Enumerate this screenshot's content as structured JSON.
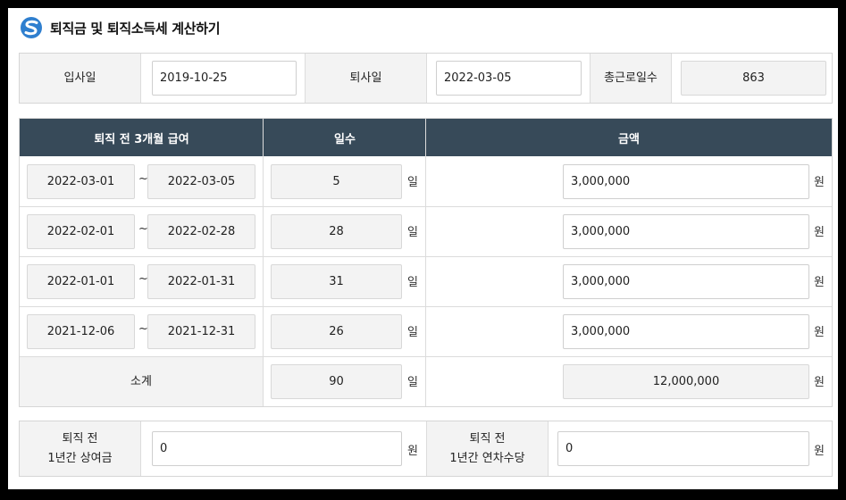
{
  "page_title": "퇴직금 및 퇴직소득세 계산하기",
  "colors": {
    "header_bg": "#374a59",
    "logo_blue": "#2f7fcf",
    "label_bg": "#f3f3f3"
  },
  "employment": {
    "start_label": "입사일",
    "start_date": "2019-10-25",
    "end_label": "퇴사일",
    "end_date": "2022-03-05",
    "total_days_label": "총근로일수",
    "total_days": "863"
  },
  "salary_table": {
    "headers": [
      "퇴직 전 3개월 급여",
      "일수",
      "금액"
    ],
    "rows": [
      {
        "from": "2022-03-01",
        "to": "2022-03-05",
        "days": "5",
        "amount": "3,000,000"
      },
      {
        "from": "2022-02-01",
        "to": "2022-02-28",
        "days": "28",
        "amount": "3,000,000"
      },
      {
        "from": "2022-01-01",
        "to": "2022-01-31",
        "days": "31",
        "amount": "3,000,000"
      },
      {
        "from": "2021-12-06",
        "to": "2021-12-31",
        "days": "26",
        "amount": "3,000,000"
      }
    ],
    "subtotal_label": "소계",
    "subtotal_days": "90",
    "subtotal_amount": "12,000,000",
    "range_sep": "~",
    "day_unit": "일",
    "won_unit": "원"
  },
  "extras": {
    "bonus_label_1": "퇴직 전",
    "bonus_label_2": "1년간 상여금",
    "bonus_value": "0",
    "leave_label_1": "퇴직 전",
    "leave_label_2": "1년간 연차수당",
    "leave_value": "0",
    "won_unit": "원"
  }
}
